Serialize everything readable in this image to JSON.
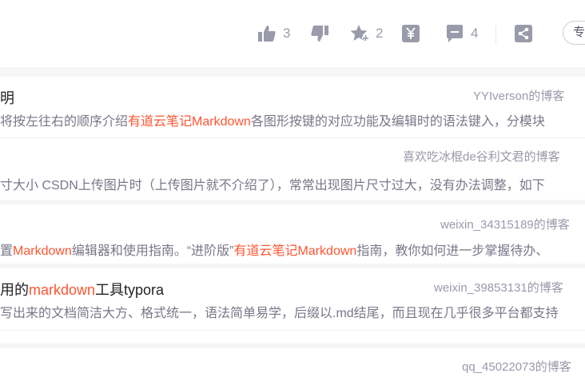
{
  "toolbar": {
    "like_count": "3",
    "collect_count": "2",
    "comment_count": "4",
    "pill_label": "专"
  },
  "results": [
    {
      "title": "明",
      "author": "YYIverson的博客",
      "desc_parts": [
        "将按左往右的顺序介绍",
        "有道云笔记Markdown",
        "各图形按键的对应功能及编辑时的语法键入，分模块"
      ]
    },
    {
      "title": "",
      "author": "喜欢吃冰棍de谷利文君的博客",
      "desc_parts": [
        "寸大小 CSDN上传图片时（上传图片就不介绍了），常常出现图片尺寸过大，没有办法调整，如下"
      ]
    },
    {
      "title": "",
      "author": "weixin_34315189的博客",
      "desc_parts": [
        "置",
        "Markdown",
        "编辑器和使用指南。“进阶版”",
        "有道云笔记Markdown",
        "指南，教你如何进一步掌握待办、"
      ]
    },
    {
      "title_parts": [
        "用的",
        "markdown",
        "工具typora"
      ],
      "author": "weixin_39853131的博客",
      "desc_parts": [
        "写出来的文档简洁大方、格式统一，语法简单易学，后缀以.md结尾，而且现在几乎很多平台都支持"
      ]
    },
    {
      "title": "",
      "author": "qq_45022073的博客",
      "desc_parts": []
    }
  ]
}
